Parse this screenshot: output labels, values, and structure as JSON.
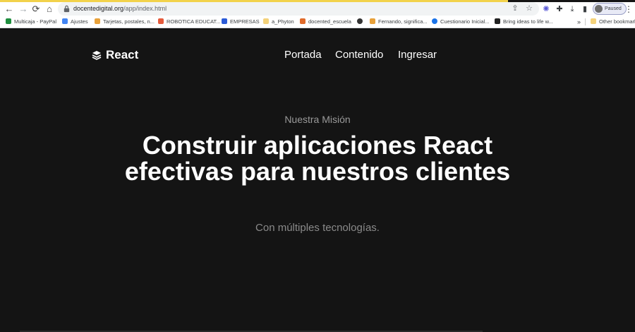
{
  "browser": {
    "load_progress": 0.8,
    "url_host": "docentedigital.org",
    "url_path": "/app/index.html",
    "profile_status": "Paused",
    "bookmarks": [
      {
        "label": "Multicaja - PayPal",
        "color": "#1e8e3e"
      },
      {
        "label": "Ajustes",
        "color": "#4285f4"
      },
      {
        "label": "Tarjetas, postales, n...",
        "color": "#e8a13a"
      },
      {
        "label": "ROBOTICA EDUCAT...",
        "color": "#e55b3c"
      },
      {
        "label": "EMPRESAS",
        "color": "#2b5bd7"
      },
      {
        "label": "a_Phyton",
        "color": "#f4d27a"
      },
      {
        "label": "docented_escuela",
        "color": "#e06b2b"
      },
      {
        "label": "",
        "color": "#333333"
      },
      {
        "label": "Fernando, significa...",
        "color": "#e8a13a"
      },
      {
        "label": "Cuestionario Inicial...",
        "color": "#1a73e8"
      },
      {
        "label": "Bring ideas to life w...",
        "color": "#222222"
      }
    ],
    "bookmarks_more": "»",
    "other_bookmarks": "Other bookmarks"
  },
  "site": {
    "logo_text": "React",
    "nav": [
      "Portada",
      "Contenido",
      "Ingresar"
    ]
  },
  "hero": {
    "eyebrow": "Nuestra Misión",
    "headline": "Construir aplicaciones React efectivas para nuestros clientes",
    "subline": "Con múltiples tecnologías."
  }
}
